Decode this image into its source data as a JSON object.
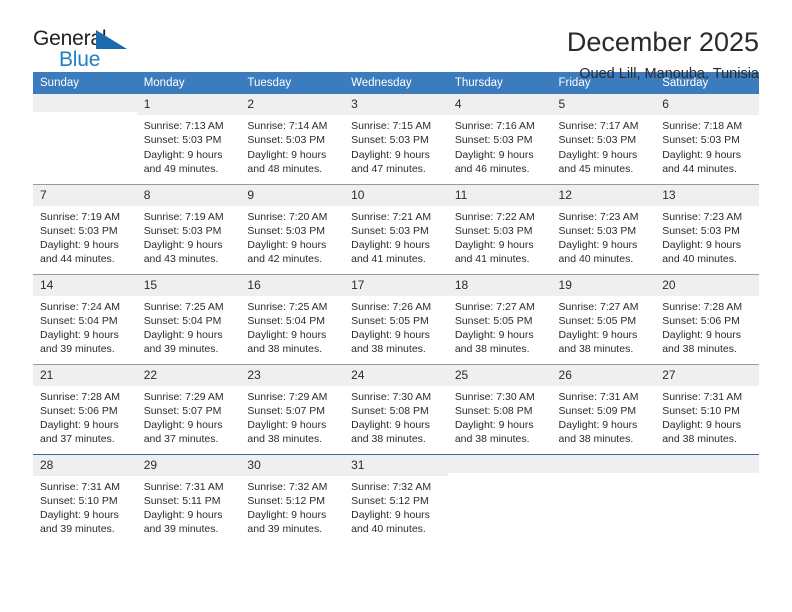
{
  "brand": {
    "name_top": "General",
    "name_bottom": "Blue",
    "triangle_color": "#1a6aad",
    "blue_color": "#1f7fc4"
  },
  "header": {
    "title": "December 2025",
    "subtitle": "Oued Lill, Manouba, Tunisia"
  },
  "theme": {
    "header_blue": "#3b7cbe",
    "daynum_band": "#efefef",
    "separator": "#9a9a9a",
    "last_separator": "#2f6da8"
  },
  "weekdays": [
    "Sunday",
    "Monday",
    "Tuesday",
    "Wednesday",
    "Thursday",
    "Friday",
    "Saturday"
  ],
  "weeks": [
    [
      {
        "day": "",
        "sunrise": "",
        "sunset": "",
        "daylight1": "",
        "daylight2": ""
      },
      {
        "day": "1",
        "sunrise": "Sunrise: 7:13 AM",
        "sunset": "Sunset: 5:03 PM",
        "daylight1": "Daylight: 9 hours",
        "daylight2": "and 49 minutes."
      },
      {
        "day": "2",
        "sunrise": "Sunrise: 7:14 AM",
        "sunset": "Sunset: 5:03 PM",
        "daylight1": "Daylight: 9 hours",
        "daylight2": "and 48 minutes."
      },
      {
        "day": "3",
        "sunrise": "Sunrise: 7:15 AM",
        "sunset": "Sunset: 5:03 PM",
        "daylight1": "Daylight: 9 hours",
        "daylight2": "and 47 minutes."
      },
      {
        "day": "4",
        "sunrise": "Sunrise: 7:16 AM",
        "sunset": "Sunset: 5:03 PM",
        "daylight1": "Daylight: 9 hours",
        "daylight2": "and 46 minutes."
      },
      {
        "day": "5",
        "sunrise": "Sunrise: 7:17 AM",
        "sunset": "Sunset: 5:03 PM",
        "daylight1": "Daylight: 9 hours",
        "daylight2": "and 45 minutes."
      },
      {
        "day": "6",
        "sunrise": "Sunrise: 7:18 AM",
        "sunset": "Sunset: 5:03 PM",
        "daylight1": "Daylight: 9 hours",
        "daylight2": "and 44 minutes."
      }
    ],
    [
      {
        "day": "7",
        "sunrise": "Sunrise: 7:19 AM",
        "sunset": "Sunset: 5:03 PM",
        "daylight1": "Daylight: 9 hours",
        "daylight2": "and 44 minutes."
      },
      {
        "day": "8",
        "sunrise": "Sunrise: 7:19 AM",
        "sunset": "Sunset: 5:03 PM",
        "daylight1": "Daylight: 9 hours",
        "daylight2": "and 43 minutes."
      },
      {
        "day": "9",
        "sunrise": "Sunrise: 7:20 AM",
        "sunset": "Sunset: 5:03 PM",
        "daylight1": "Daylight: 9 hours",
        "daylight2": "and 42 minutes."
      },
      {
        "day": "10",
        "sunrise": "Sunrise: 7:21 AM",
        "sunset": "Sunset: 5:03 PM",
        "daylight1": "Daylight: 9 hours",
        "daylight2": "and 41 minutes."
      },
      {
        "day": "11",
        "sunrise": "Sunrise: 7:22 AM",
        "sunset": "Sunset: 5:03 PM",
        "daylight1": "Daylight: 9 hours",
        "daylight2": "and 41 minutes."
      },
      {
        "day": "12",
        "sunrise": "Sunrise: 7:23 AM",
        "sunset": "Sunset: 5:03 PM",
        "daylight1": "Daylight: 9 hours",
        "daylight2": "and 40 minutes."
      },
      {
        "day": "13",
        "sunrise": "Sunrise: 7:23 AM",
        "sunset": "Sunset: 5:03 PM",
        "daylight1": "Daylight: 9 hours",
        "daylight2": "and 40 minutes."
      }
    ],
    [
      {
        "day": "14",
        "sunrise": "Sunrise: 7:24 AM",
        "sunset": "Sunset: 5:04 PM",
        "daylight1": "Daylight: 9 hours",
        "daylight2": "and 39 minutes."
      },
      {
        "day": "15",
        "sunrise": "Sunrise: 7:25 AM",
        "sunset": "Sunset: 5:04 PM",
        "daylight1": "Daylight: 9 hours",
        "daylight2": "and 39 minutes."
      },
      {
        "day": "16",
        "sunrise": "Sunrise: 7:25 AM",
        "sunset": "Sunset: 5:04 PM",
        "daylight1": "Daylight: 9 hours",
        "daylight2": "and 38 minutes."
      },
      {
        "day": "17",
        "sunrise": "Sunrise: 7:26 AM",
        "sunset": "Sunset: 5:05 PM",
        "daylight1": "Daylight: 9 hours",
        "daylight2": "and 38 minutes."
      },
      {
        "day": "18",
        "sunrise": "Sunrise: 7:27 AM",
        "sunset": "Sunset: 5:05 PM",
        "daylight1": "Daylight: 9 hours",
        "daylight2": "and 38 minutes."
      },
      {
        "day": "19",
        "sunrise": "Sunrise: 7:27 AM",
        "sunset": "Sunset: 5:05 PM",
        "daylight1": "Daylight: 9 hours",
        "daylight2": "and 38 minutes."
      },
      {
        "day": "20",
        "sunrise": "Sunrise: 7:28 AM",
        "sunset": "Sunset: 5:06 PM",
        "daylight1": "Daylight: 9 hours",
        "daylight2": "and 38 minutes."
      }
    ],
    [
      {
        "day": "21",
        "sunrise": "Sunrise: 7:28 AM",
        "sunset": "Sunset: 5:06 PM",
        "daylight1": "Daylight: 9 hours",
        "daylight2": "and 37 minutes."
      },
      {
        "day": "22",
        "sunrise": "Sunrise: 7:29 AM",
        "sunset": "Sunset: 5:07 PM",
        "daylight1": "Daylight: 9 hours",
        "daylight2": "and 37 minutes."
      },
      {
        "day": "23",
        "sunrise": "Sunrise: 7:29 AM",
        "sunset": "Sunset: 5:07 PM",
        "daylight1": "Daylight: 9 hours",
        "daylight2": "and 38 minutes."
      },
      {
        "day": "24",
        "sunrise": "Sunrise: 7:30 AM",
        "sunset": "Sunset: 5:08 PM",
        "daylight1": "Daylight: 9 hours",
        "daylight2": "and 38 minutes."
      },
      {
        "day": "25",
        "sunrise": "Sunrise: 7:30 AM",
        "sunset": "Sunset: 5:08 PM",
        "daylight1": "Daylight: 9 hours",
        "daylight2": "and 38 minutes."
      },
      {
        "day": "26",
        "sunrise": "Sunrise: 7:31 AM",
        "sunset": "Sunset: 5:09 PM",
        "daylight1": "Daylight: 9 hours",
        "daylight2": "and 38 minutes."
      },
      {
        "day": "27",
        "sunrise": "Sunrise: 7:31 AM",
        "sunset": "Sunset: 5:10 PM",
        "daylight1": "Daylight: 9 hours",
        "daylight2": "and 38 minutes."
      }
    ],
    [
      {
        "day": "28",
        "sunrise": "Sunrise: 7:31 AM",
        "sunset": "Sunset: 5:10 PM",
        "daylight1": "Daylight: 9 hours",
        "daylight2": "and 39 minutes."
      },
      {
        "day": "29",
        "sunrise": "Sunrise: 7:31 AM",
        "sunset": "Sunset: 5:11 PM",
        "daylight1": "Daylight: 9 hours",
        "daylight2": "and 39 minutes."
      },
      {
        "day": "30",
        "sunrise": "Sunrise: 7:32 AM",
        "sunset": "Sunset: 5:12 PM",
        "daylight1": "Daylight: 9 hours",
        "daylight2": "and 39 minutes."
      },
      {
        "day": "31",
        "sunrise": "Sunrise: 7:32 AM",
        "sunset": "Sunset: 5:12 PM",
        "daylight1": "Daylight: 9 hours",
        "daylight2": "and 40 minutes."
      },
      {
        "day": "",
        "sunrise": "",
        "sunset": "",
        "daylight1": "",
        "daylight2": ""
      },
      {
        "day": "",
        "sunrise": "",
        "sunset": "",
        "daylight1": "",
        "daylight2": ""
      },
      {
        "day": "",
        "sunrise": "",
        "sunset": "",
        "daylight1": "",
        "daylight2": ""
      }
    ]
  ]
}
